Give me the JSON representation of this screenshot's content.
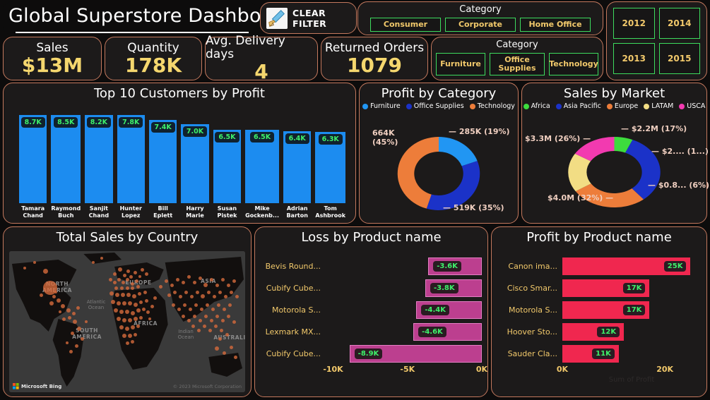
{
  "header": {
    "title": "Global Superstore Dashboard",
    "clear_filter_label": "CLEAR FILTER",
    "clear_filter_icon": "broom-icon"
  },
  "kpis": [
    {
      "label": "Sales",
      "value": "$13M"
    },
    {
      "label": "Quantity",
      "value": "178K"
    },
    {
      "label": "Avg. Delivery days",
      "value": "4"
    },
    {
      "label": "Returned Orders",
      "value": "1079"
    }
  ],
  "slicers": {
    "segment": {
      "title": "Category",
      "options": [
        "Consumer",
        "Corporate",
        "Home Office"
      ]
    },
    "category": {
      "title": "Category",
      "options": [
        "Furniture",
        "Office Supplies",
        "Technology"
      ]
    },
    "years": [
      "2012",
      "2014",
      "2013",
      "2015"
    ]
  },
  "colors": {
    "panel_border": "#c4795e",
    "panel_bg": "#1c1a1a",
    "kpi_value": "#f5d76e",
    "slicer_border": "#3ddc5e",
    "slicer_text": "#f2c96b",
    "column_bar": "#1c8cf0",
    "data_label": "#3ef06a",
    "loss_bar": "#bc3f8f",
    "profit_bar": "#f0274f",
    "map_bubble": "#d66a3c"
  },
  "chart_data": [
    {
      "type": "bar",
      "id": "top-customers",
      "title": "Top 10 Customers by Profit",
      "orientation": "vertical",
      "categories": [
        "Tamara Chand",
        "Raymond Buch",
        "Sanjit Chand",
        "Hunter Lopez",
        "Bill Eplett",
        "Harry Marie",
        "Susan Pistek",
        "Mike Gockenb...",
        "Adrian Barton",
        "Tom Ashbrook"
      ],
      "category_lines": [
        [
          "Tamara",
          "Chand"
        ],
        [
          "Raymond",
          "Buch"
        ],
        [
          "Sanjit",
          "Chand"
        ],
        [
          "Hunter",
          "Lopez"
        ],
        [
          "Bill Eplett",
          ""
        ],
        [
          "Harry",
          "Marie"
        ],
        [
          "Susan",
          "Pistek"
        ],
        [
          "Mike",
          "Gockenb..."
        ],
        [
          "Adrian",
          "Barton"
        ],
        [
          "Tom",
          "Ashbrook"
        ]
      ],
      "values": [
        8.7,
        8.5,
        8.2,
        7.8,
        7.4,
        7.0,
        6.5,
        6.5,
        6.4,
        6.3
      ],
      "labels": [
        "8.7K",
        "8.5K",
        "8.2K",
        "7.8K",
        "7.4K",
        "7.0K",
        "6.5K",
        "6.5K",
        "6.4K",
        "6.3K"
      ],
      "ylim": [
        0,
        9.2
      ],
      "xlabel": "",
      "ylabel": "",
      "grid": false,
      "legend": "none"
    },
    {
      "type": "pie",
      "id": "profit-by-category",
      "title": "Profit by Category",
      "donut": true,
      "legend_position": "top",
      "labels": [
        "Furniture",
        "Office Supplies",
        "Technology"
      ],
      "values": [
        285,
        519,
        664
      ],
      "percents": [
        19,
        35,
        45
      ],
      "colors": [
        "#2196f3",
        "#1b32c8",
        "#ed7d3a"
      ],
      "annotations": [
        "285K (19%)",
        "519K (35%)",
        "664K\n(45%)"
      ],
      "annotation_flat": [
        "285K (19%)",
        "519K (35%)",
        "664K",
        "(45%)"
      ]
    },
    {
      "type": "pie",
      "id": "sales-by-market",
      "title": "Sales by Market",
      "donut": true,
      "legend_position": "top",
      "labels": [
        "Africa",
        "Asia Pacific",
        "Europe",
        "LATAM",
        "USCA"
      ],
      "values": [
        0.8,
        4.0,
        3.3,
        2.2,
        2.0
      ],
      "percents": [
        6,
        32,
        26,
        17,
        16
      ],
      "colors": [
        "#3ddc3d",
        "#1b32c8",
        "#ed7d3a",
        "#f2dd84",
        "#f23ab0"
      ],
      "annotations": [
        "$0.8... (6%)",
        "$4.0M (32%)",
        "$3.3M (26%)",
        "$2.2M (17%)",
        "$2.... (1...)"
      ]
    },
    {
      "type": "bar",
      "id": "loss-by-product",
      "title": "Loss by Product name",
      "orientation": "horizontal",
      "categories": [
        "Bevis Round...",
        "Cubify Cube...",
        "Motorola S...",
        "Lexmark MX...",
        "Cubify Cube..."
      ],
      "values": [
        -3.6,
        -3.8,
        -4.4,
        -4.6,
        -8.9
      ],
      "labels": [
        "-3.6K",
        "-3.8K",
        "-4.4K",
        "-4.6K",
        "-8.9K"
      ],
      "xticks": [
        "-10K",
        "-5K",
        "0K"
      ],
      "xlim": [
        -10.5,
        0
      ],
      "grid": false,
      "legend": "none",
      "xlabel": "",
      "ylabel": ""
    },
    {
      "type": "bar",
      "id": "profit-by-product",
      "title": "Profit by Product name",
      "orientation": "horizontal",
      "categories": [
        "Canon ima...",
        "Cisco Smar...",
        "Motorola S...",
        "Hoover Sto...",
        "Sauder Cla..."
      ],
      "values": [
        25,
        17,
        17,
        12,
        11
      ],
      "labels": [
        "25K",
        "17K",
        "17K",
        "12K",
        "11K"
      ],
      "xticks": [
        "0K",
        "20K"
      ],
      "xlim": [
        0,
        27
      ],
      "axis_title": "Sum of Profit",
      "grid": false,
      "legend": "none",
      "ylabel": ""
    }
  ],
  "map": {
    "title": "Total Sales by Country",
    "provider_label": "Microsoft Bing",
    "attribution": "© 2023 Microsoft Corporation",
    "continent_labels": [
      "NORTH AMERICA",
      "SOUTH AMERICA",
      "EUROPE",
      "AFRICA",
      "ASIA",
      "AUSTRALI"
    ],
    "ocean_labels": [
      "Atlantic Ocean",
      "Indian Ocean"
    ]
  }
}
